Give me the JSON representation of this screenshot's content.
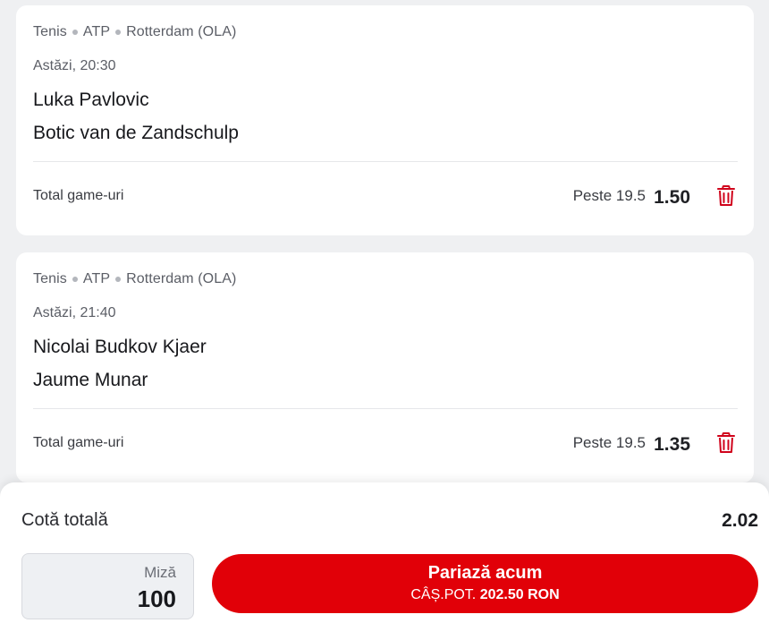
{
  "bets": [
    {
      "sport": "Tenis",
      "tour": "ATP",
      "tournament": "Rotterdam (OLA)",
      "time": "Astăzi, 20:30",
      "home": "Luka Pavlovic",
      "away": "Botic van de Zandschulp",
      "market": "Total game-uri",
      "selection": "Peste 19.5",
      "odd": "1.50"
    },
    {
      "sport": "Tenis",
      "tour": "ATP",
      "tournament": "Rotterdam (OLA)",
      "time": "Astăzi, 21:40",
      "home": "Nicolai Budkov Kjaer",
      "away": "Jaume Munar",
      "market": "Total game-uri",
      "selection": "Peste 19.5",
      "odd": "1.35"
    }
  ],
  "slip": {
    "total_label": "Cotă totală",
    "total_value": "2.02",
    "stake_label": "Miză",
    "stake_value": "100",
    "bet_button_label": "Pariază acum",
    "potential_label": "CÂȘ.POT.",
    "potential_value": "202.50 RON"
  },
  "icons": {
    "remove": "trash-icon"
  },
  "colors": {
    "accent": "#e10008",
    "background": "#eff0f2"
  }
}
